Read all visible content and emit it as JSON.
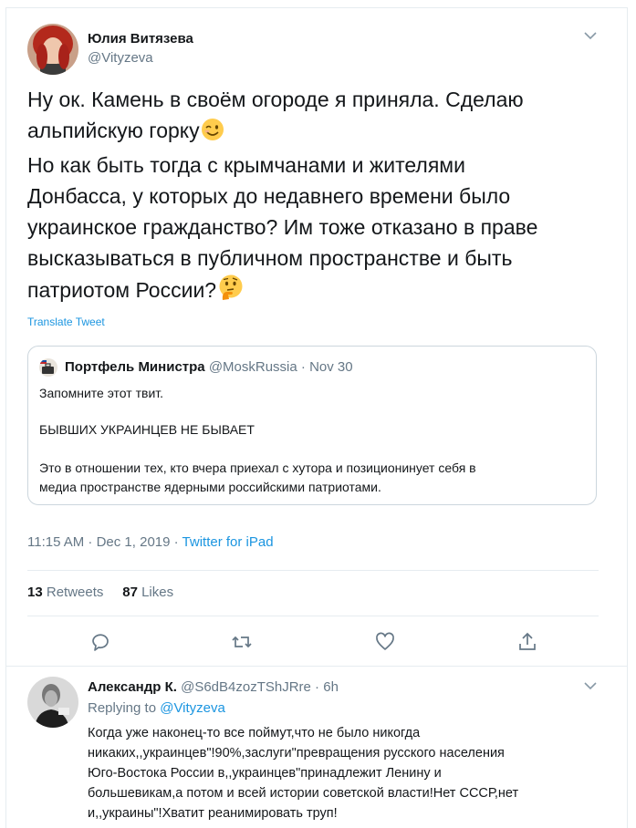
{
  "tweet": {
    "author_name": "Юлия Витязева",
    "author_handle": "@Vityzeva",
    "text_lines": [
      "Ну ок. Камень в своём огороде я приняла. Сделаю",
      "альпийскую горку",
      "Но как быть тогда с крымчанами и жителями",
      "Донбасса, у которых до недавнего времени было",
      "украинское гражданство? Им тоже отказано в праве",
      "высказываться в публичном пространстве и быть",
      "патриотом России?"
    ],
    "emoji_1": "winking-face",
    "emoji_2": "thinking-face",
    "translate_label": "Translate Tweet",
    "timestamp": "11:15 AM · Dec 1, 2019 · ",
    "source": "Twitter for iPad",
    "retweets_count": "13",
    "retweets_label": "Retweets",
    "likes_count": "87",
    "likes_label": "Likes"
  },
  "quote": {
    "author_name": "Портфель Министра",
    "author_handle": "@MoskRussia",
    "date": " · Nov 30",
    "lines": [
      "Запомните этот твит.",
      "БЫВШИХ УКРАИНЦЕВ НЕ БЫВАЕТ",
      "Это в отношении тех, кто вчера приехал с хутора и позиционинует себя в",
      "медиа пространстве ядерными российскими патриотами."
    ]
  },
  "reply": {
    "author_name": "Александр К.",
    "author_handle": "@S6dB4zozTShJRre",
    "time": " · 6h",
    "replying_prefix": "Replying to ",
    "replying_to": "@Vityzeva",
    "text_lines": [
      "Когда уже наконец-то все поймут,что не было никогда",
      "никаких,,украинцев\"!90%,заслуги\"превращения русского населения",
      "Юго-Востока России в,,украинцев\"принадлежит Ленину и",
      "большевикам,а потом и всей истории советской власти!Нет СССР,нет",
      "и,,украины\"!Хватит реанимировать труп!"
    ]
  },
  "colors": {
    "link_blue": "#1b95e0",
    "secondary_gray": "#657786",
    "text_dark": "#14171a",
    "border": "#e6ecf0"
  }
}
